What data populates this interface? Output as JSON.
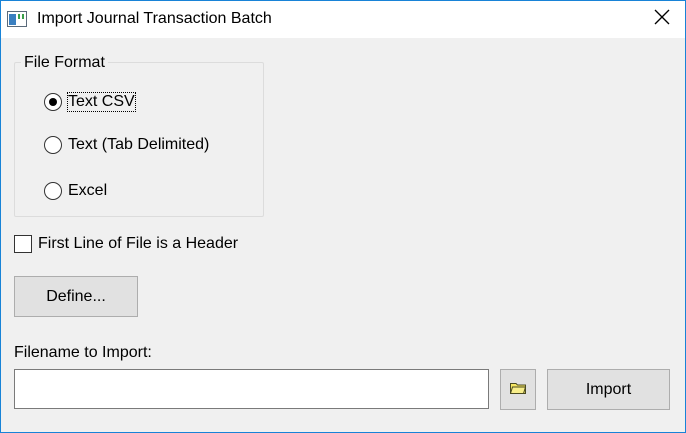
{
  "window": {
    "title": "Import Journal Transaction Batch"
  },
  "file_format": {
    "label": "File Format",
    "options": [
      {
        "label": "Text CSV",
        "selected": true
      },
      {
        "label": "Text (Tab Delimited)",
        "selected": false
      },
      {
        "label": "Excel",
        "selected": false
      }
    ]
  },
  "header_checkbox": {
    "label": "First Line of File is a Header",
    "checked": false
  },
  "buttons": {
    "define": "Define...",
    "import": "Import"
  },
  "filename": {
    "label": "Filename to Import:",
    "value": "",
    "browse_icon": "folder-icon"
  },
  "colors": {
    "window_border": "#1883d7",
    "background": "#f0f0f0",
    "folder_yellow": "#f5e663"
  }
}
